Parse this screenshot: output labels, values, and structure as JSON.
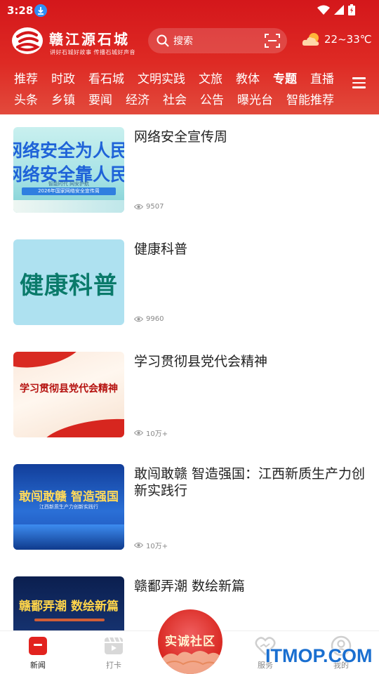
{
  "status": {
    "time": "3:28"
  },
  "app": {
    "title": "赣江源石城",
    "slogan": "讲好石城好故事 传播石城好声音"
  },
  "search": {
    "placeholder": "搜索"
  },
  "weather": {
    "temperature": "22~33℃",
    "icon": "partly-cloudy-icon"
  },
  "categories": {
    "row1": [
      "推荐",
      "时政",
      "看石城",
      "文明实践",
      "文旅",
      "教体",
      "专题",
      "直播"
    ],
    "row2": [
      "头条",
      "乡镇",
      "要闻",
      "经济",
      "社会",
      "公告",
      "曝光台",
      "智能推荐"
    ],
    "active": "专题"
  },
  "articles": [
    {
      "title": "网络安全宣传周",
      "views": "9507",
      "thumb": {
        "line1": "网络安全为人民",
        "line2": "网络安全靠人民",
        "sub": "智能时代 网安护航",
        "banner": "2026年国家网络安全宣传周"
      }
    },
    {
      "title": "健康科普",
      "views": "9960",
      "thumb": {
        "text": "健康科普"
      }
    },
    {
      "title": "学习贯彻县党代会精神",
      "views": "10万+",
      "thumb": {
        "text": "学习贯彻县党代会精神"
      }
    },
    {
      "title": "敢闯敢赣 智造强国：江西新质生产力创新实践行",
      "views": "10万+",
      "thumb": {
        "text": "敢闯敢赣 智造强国",
        "sub": "江西新质生产力创新实践行"
      }
    },
    {
      "title": "赣鄱弄潮 数绘新篇",
      "views": "",
      "thumb": {
        "text": "赣鄱弄潮 数绘新篇"
      }
    }
  ],
  "tabbar": {
    "items": [
      {
        "label": "新闻",
        "icon": "news-icon",
        "active": true
      },
      {
        "label": "打卡",
        "icon": "video-icon",
        "active": false
      },
      {
        "label": "服务",
        "icon": "service-icon",
        "active": false
      },
      {
        "label": "我的",
        "icon": "profile-icon",
        "active": false
      }
    ],
    "center": {
      "label": "实诚社区"
    }
  },
  "watermark": "ITMOP.COM",
  "colors": {
    "brand_red": "#d4171b",
    "accent_blue": "#1a6fd0"
  }
}
